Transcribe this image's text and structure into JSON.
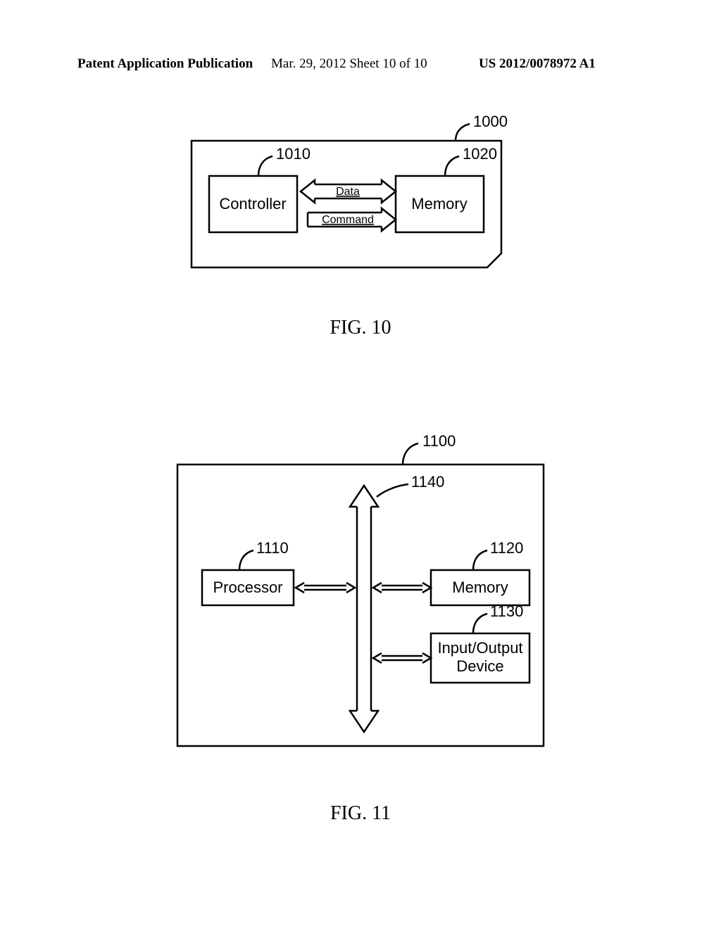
{
  "header": {
    "left": "Patent Application Publication",
    "mid": "Mar. 29, 2012  Sheet 10 of 10",
    "right": "US 2012/0078972 A1"
  },
  "fig10": {
    "caption": "FIG. 10",
    "ref_main": "1000",
    "ref_left": "1010",
    "ref_right": "1020",
    "box_left": "Controller",
    "box_right": "Memory",
    "label_top": "Data",
    "label_bottom": "Command"
  },
  "fig11": {
    "caption": "FIG. 11",
    "ref_main": "1100",
    "ref_proc": "1110",
    "ref_mem": "1120",
    "ref_io": "1130",
    "ref_bus": "1140",
    "box_proc": "Processor",
    "box_mem": "Memory",
    "box_io_line1": "Input/Output",
    "box_io_line2": "Device"
  }
}
